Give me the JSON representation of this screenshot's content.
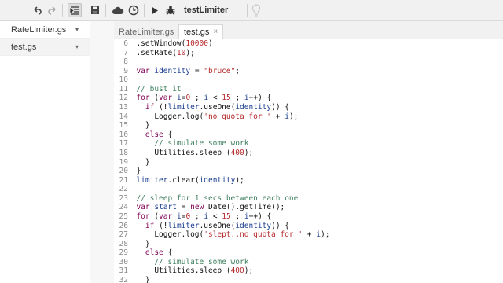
{
  "toolbar": {
    "function_select": "testLimiter",
    "icons": [
      "undo-icon",
      "redo-icon",
      "indent-icon",
      "save-icon",
      "cloud-icon",
      "clock-icon",
      "run-icon",
      "debug-icon",
      "lightbulb-icon"
    ]
  },
  "sidebar": {
    "files": [
      {
        "name": "RateLimiter.gs",
        "menu": "▾"
      },
      {
        "name": "test.gs",
        "menu": "▾"
      }
    ]
  },
  "tabs": [
    {
      "label": "RateLimiter.gs"
    },
    {
      "label": "test.gs",
      "close": "×"
    }
  ],
  "colors": {
    "keyword": "#7f0055",
    "string": "#b5282a",
    "comment": "#3f7f5f",
    "variable": "#1a3d8f"
  },
  "code": {
    "lines": [
      {
        "num": "6",
        "text": "  .setWindow(10000)"
      },
      {
        "num": "7",
        "text": "  .setRate(10);"
      },
      {
        "num": "8",
        "text": ""
      },
      {
        "num": "9",
        "text": "  var identity = \"bruce\";"
      },
      {
        "num": "10",
        "text": ""
      },
      {
        "num": "11",
        "text": "  // bust it"
      },
      {
        "num": "12",
        "text": "  for (var i=0 ; i < 15 ; i++) {"
      },
      {
        "num": "13",
        "text": "    if (!limiter.useOne(identity)) {"
      },
      {
        "num": "14",
        "text": "      Logger.log('no quota for ' + i);"
      },
      {
        "num": "15",
        "text": "    }"
      },
      {
        "num": "16",
        "text": "    else {"
      },
      {
        "num": "17",
        "text": "      // simulate some work"
      },
      {
        "num": "18",
        "text": "      Utilities.sleep (400);"
      },
      {
        "num": "19",
        "text": "    }"
      },
      {
        "num": "20",
        "text": "  }"
      },
      {
        "num": "21",
        "text": "  limiter.clear(identity);"
      },
      {
        "num": "22",
        "text": ""
      },
      {
        "num": "23",
        "text": "  // sleep for 1 secs between each one"
      },
      {
        "num": "24",
        "text": "  var start = new Date().getTime();"
      },
      {
        "num": "25",
        "text": "  for (var i=0 ; i < 15 ; i++) {"
      },
      {
        "num": "26",
        "text": "    if (!limiter.useOne(identity)) {"
      },
      {
        "num": "27",
        "text": "      Logger.log('slept..no quota for ' + i);"
      },
      {
        "num": "28",
        "text": "    }"
      },
      {
        "num": "29",
        "text": "    else {"
      },
      {
        "num": "30",
        "text": "      // simulate some work"
      },
      {
        "num": "31",
        "text": "      Utilities.sleep (400);"
      },
      {
        "num": "32",
        "text": "    }"
      }
    ]
  }
}
